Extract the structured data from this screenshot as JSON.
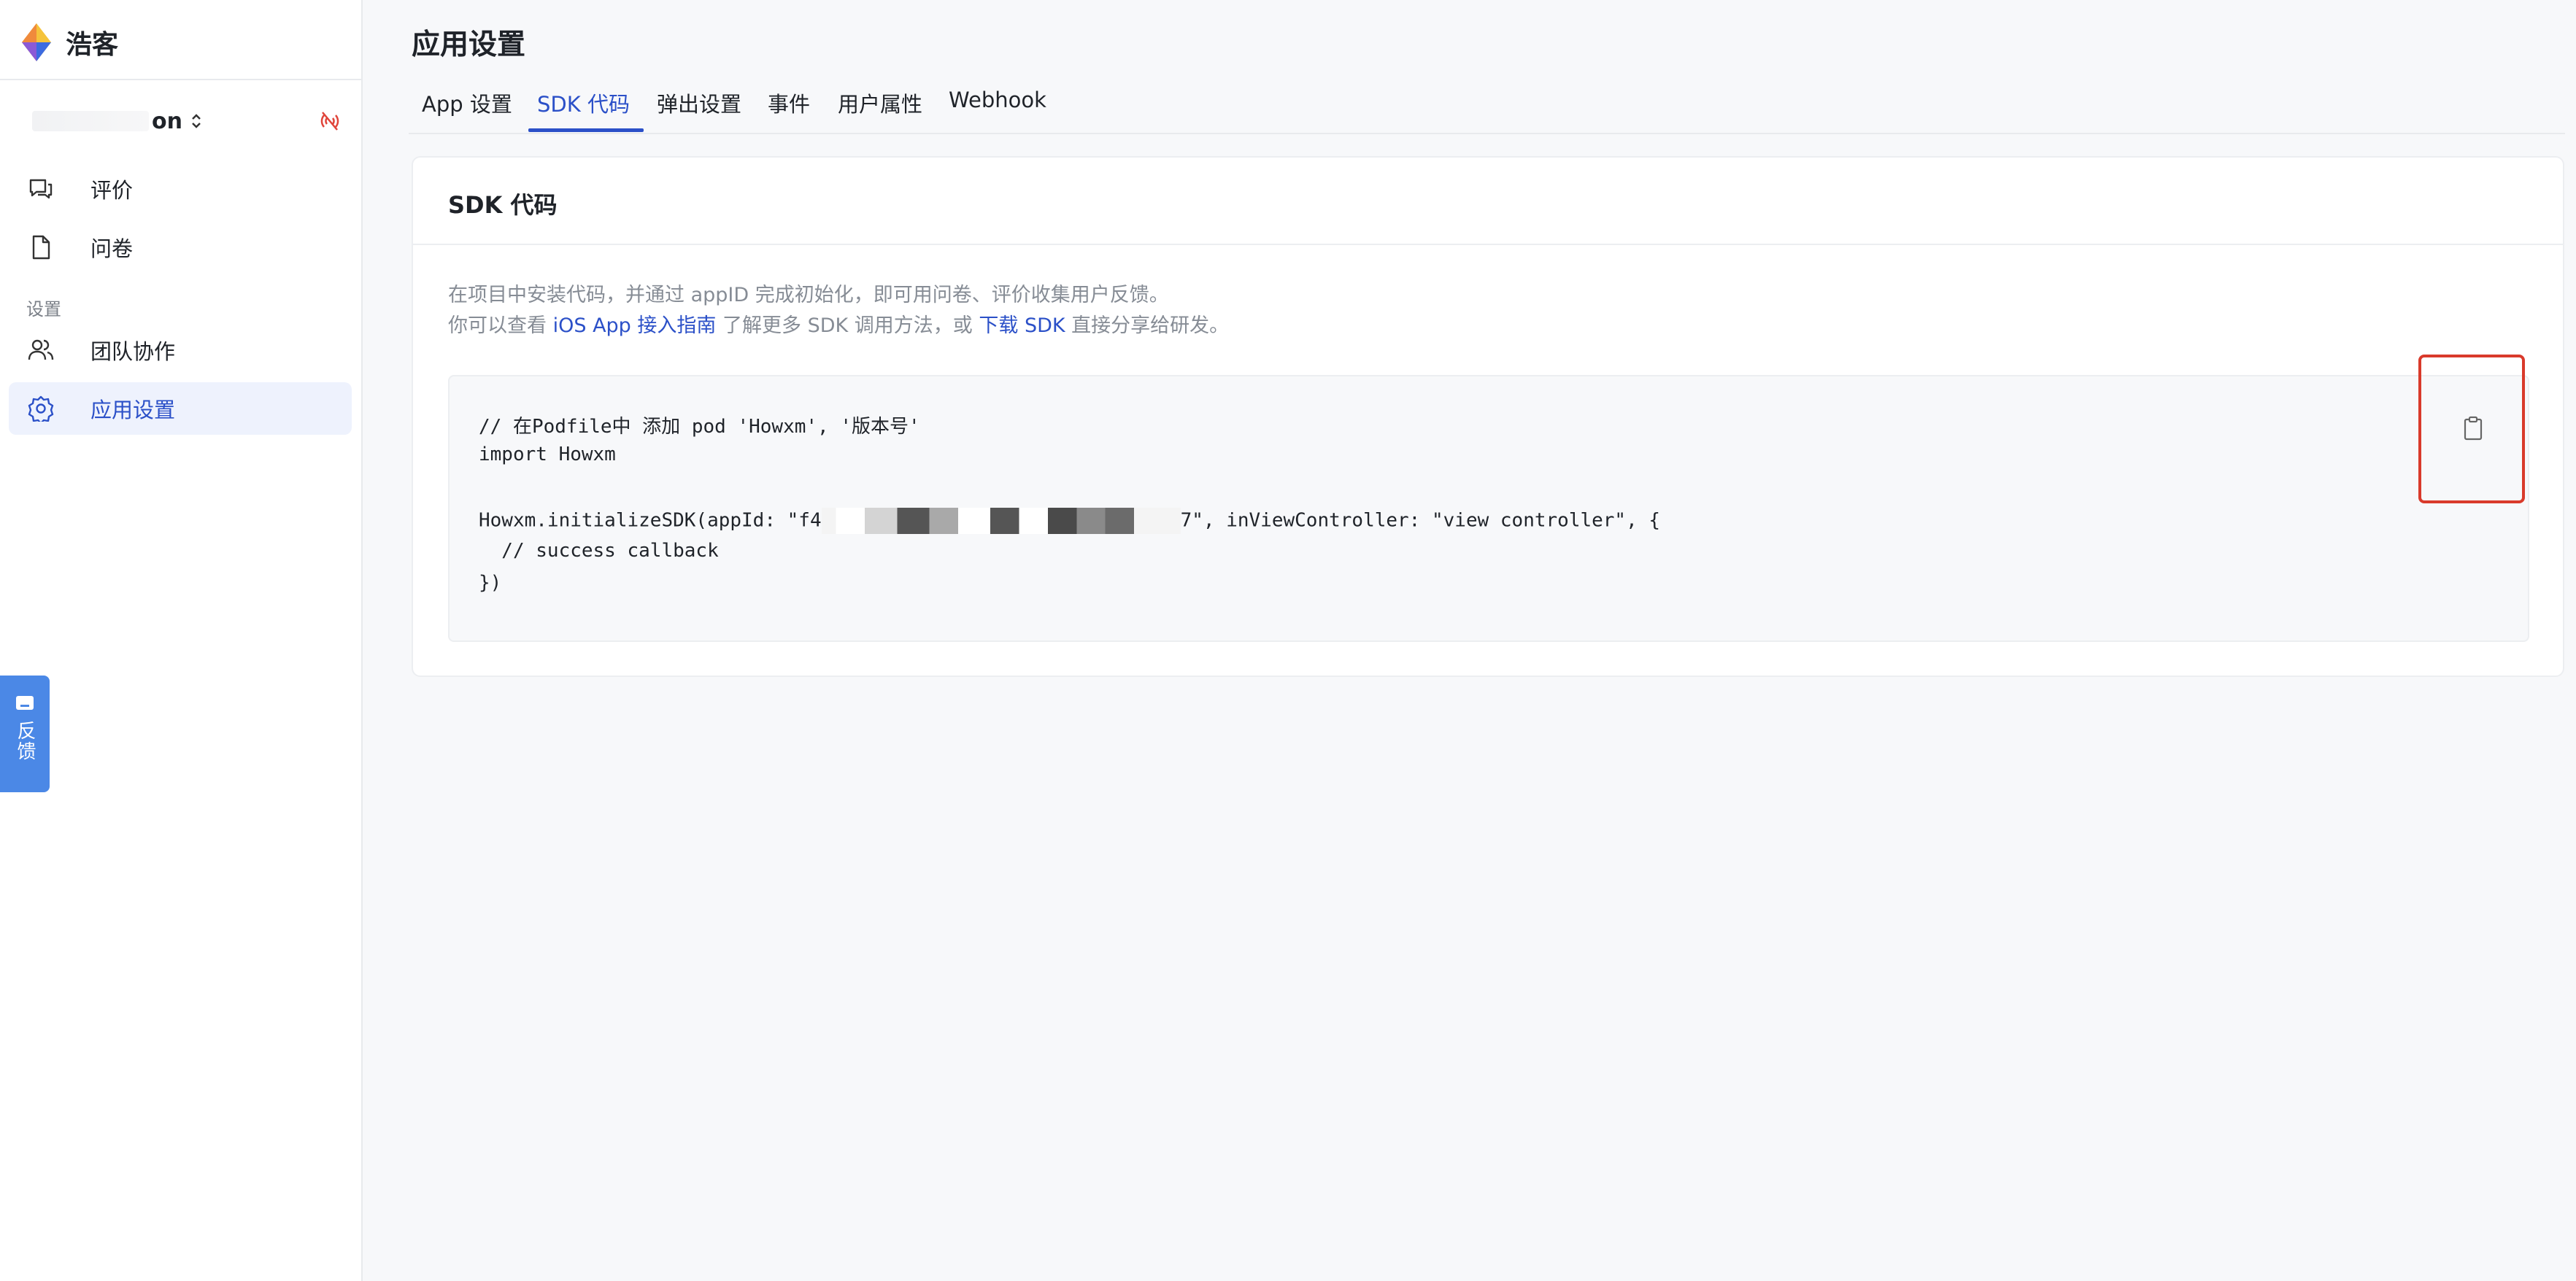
{
  "brand": {
    "name": "浩客"
  },
  "project": {
    "name_suffix": "on",
    "caret": "⌃⌄"
  },
  "sidebar": {
    "items": [
      {
        "label": "评价",
        "icon": "chat-bubbles-icon"
      },
      {
        "label": "问卷",
        "icon": "document-icon"
      }
    ],
    "section_label": "设置",
    "settings_items": [
      {
        "label": "团队协作",
        "icon": "users-icon"
      },
      {
        "label": "应用设置",
        "icon": "gear-icon",
        "active": true
      }
    ]
  },
  "feedback": {
    "label": "反馈",
    "icon": "message-icon"
  },
  "page": {
    "title": "应用设置"
  },
  "tabs": [
    {
      "label": "App 设置"
    },
    {
      "label": "SDK 代码",
      "active": true
    },
    {
      "label": "弹出设置"
    },
    {
      "label": "事件"
    },
    {
      "label": "用户属性"
    },
    {
      "label": "Webhook"
    }
  ],
  "card": {
    "title": "SDK 代码",
    "desc_line1": "在项目中安装代码，并通过 appID 完成初始化，即可用问卷、评价收集用户反馈。",
    "desc_line2_a": "你可以查看 ",
    "desc_link1": "iOS App 接入指南",
    "desc_line2_b": " 了解更多 SDK 调用方法，或 ",
    "desc_link2": "下载 SDK",
    "desc_line2_c": " 直接分享给研发。"
  },
  "code": {
    "line1": "// 在Podfile中 添加 pod 'Howxm', '版本号'",
    "line2": "import Howxm",
    "line3_a": "Howxm.initializeSDK(appId: \"f4",
    "line3_b": "7\", inViewController: \"view controller\", {",
    "line4": "  // success callback",
    "line5": "})"
  },
  "colors": {
    "accent": "#2b50c8",
    "highlight": "#d93a2b",
    "feedback": "#4b88e6"
  }
}
